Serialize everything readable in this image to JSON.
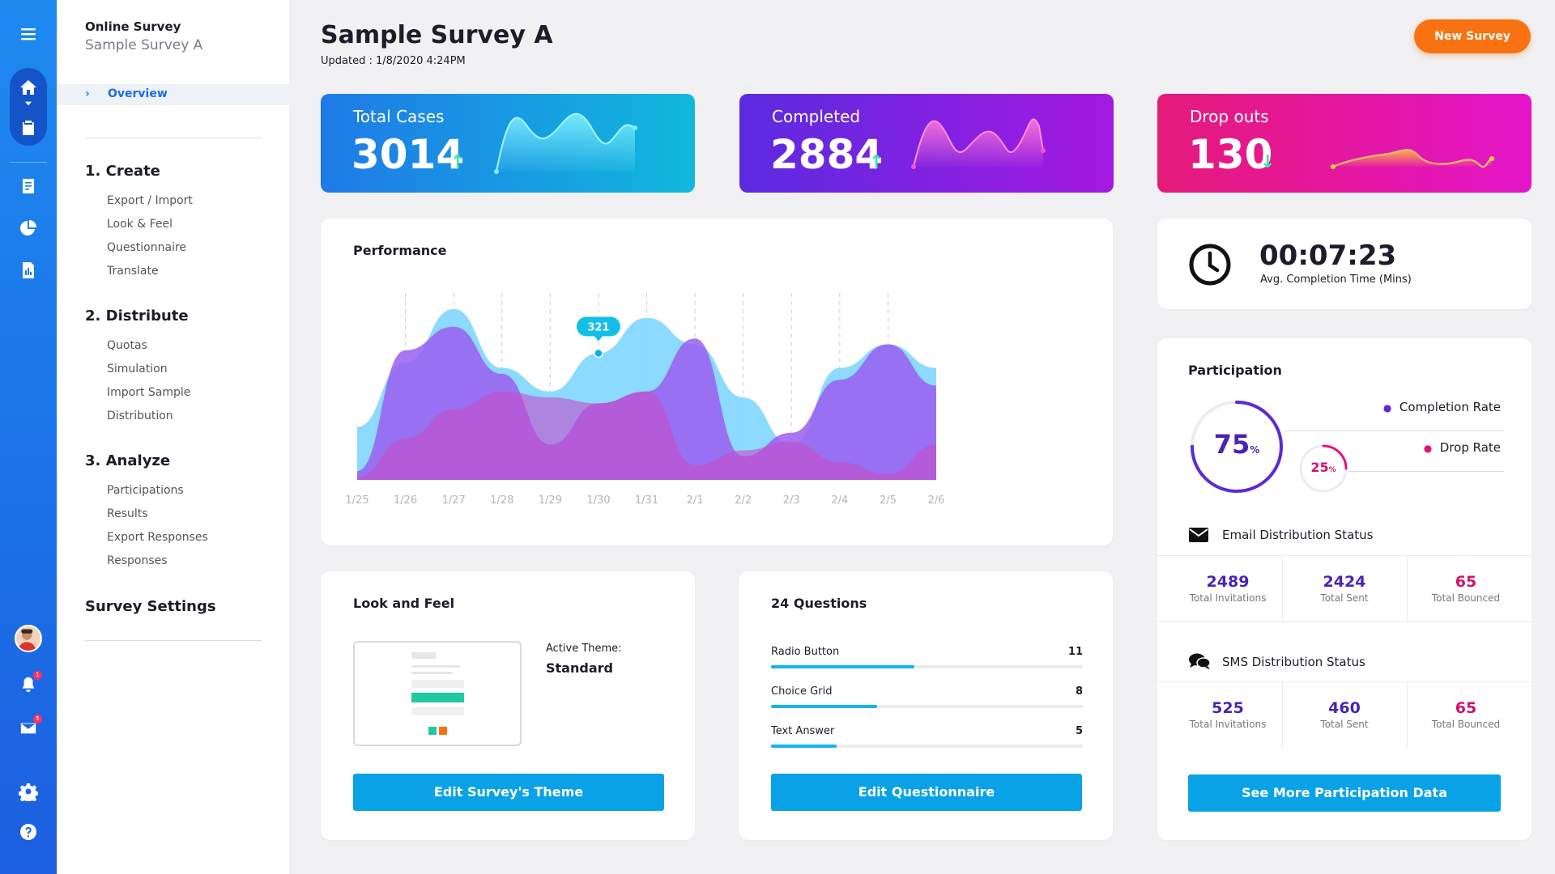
{
  "app": {
    "name": "Online Survey",
    "survey": "Sample Survey A"
  },
  "sidebar": {
    "overview": "Overview",
    "sections": [
      {
        "title": "1. Create",
        "items": [
          "Export / Import",
          "Look & Feel",
          "Questionnaire",
          "Translate"
        ]
      },
      {
        "title": "2. Distribute",
        "items": [
          "Quotas",
          "Simulation",
          "Import Sample",
          "Distribution"
        ]
      },
      {
        "title": "3. Analyze",
        "items": [
          "Participations",
          "Results",
          "Export Responses",
          "Responses"
        ]
      }
    ],
    "settings": "Survey Settings"
  },
  "rail": {
    "notif_badge": "1",
    "mail_badge": "5"
  },
  "header": {
    "title": "Sample Survey A",
    "updated": "Updated : 1/8/2020 4:24PM",
    "new_button": "New Survey"
  },
  "stats": [
    {
      "title": "Total Cases",
      "value": "3014",
      "trend": "up"
    },
    {
      "title": "Completed",
      "value": "2884",
      "trend": "up"
    },
    {
      "title": "Drop outs",
      "value": "130",
      "trend": "down"
    }
  ],
  "performance": {
    "title": "Performance",
    "tooltip": "321"
  },
  "chart_data": {
    "type": "area",
    "title": "Performance",
    "categories": [
      "1/25",
      "1/26",
      "1/27",
      "1/28",
      "1/29",
      "1/30",
      "1/31",
      "2/1",
      "2/2",
      "2/3",
      "2/4",
      "2/5",
      "2/6"
    ],
    "series": [
      {
        "values": [
          90,
          200,
          290,
          190,
          150,
          215,
          275,
          230,
          140,
          60,
          190,
          230,
          190
        ]
      },
      {
        "values": [
          15,
          220,
          260,
          180,
          60,
          130,
          150,
          240,
          40,
          80,
          170,
          230,
          160
        ]
      },
      {
        "values": [
          5,
          70,
          120,
          150,
          140,
          130,
          150,
          25,
          50,
          65,
          30,
          10,
          60
        ]
      }
    ],
    "ylim": [
      0,
      320
    ],
    "highlight": {
      "category": "1/30",
      "value": 321
    },
    "grid": "vertical dashed"
  },
  "avg_time": {
    "value": "00:07:23",
    "label": "Avg. Completion Time (Mins)"
  },
  "participation": {
    "title": "Participation",
    "completion": {
      "label": "Completion Rate",
      "value": "75",
      "unit": "%",
      "fraction": 0.75
    },
    "drop": {
      "label": "Drop Rate",
      "value": "25",
      "unit": "%",
      "fraction": 0.25
    },
    "email": {
      "title": "Email Distribution Status",
      "stats": [
        {
          "value": "2489",
          "label": "Total Invitations"
        },
        {
          "value": "2424",
          "label": "Total Sent"
        },
        {
          "value": "65",
          "label": "Total Bounced"
        }
      ]
    },
    "sms": {
      "title": "SMS Distribution Status",
      "stats": [
        {
          "value": "525",
          "label": "Total Invitations"
        },
        {
          "value": "460",
          "label": "Total Sent"
        },
        {
          "value": "65",
          "label": "Total Bounced"
        }
      ]
    },
    "button": "See More Participation Data"
  },
  "look": {
    "title": "Look and Feel",
    "theme_label": "Active Theme:",
    "theme": "Standard",
    "button": "Edit Survey's Theme"
  },
  "questions": {
    "title": "24 Questions",
    "items": [
      {
        "label": "Radio Button",
        "count": "11",
        "fraction": 0.46
      },
      {
        "label": "Choice Grid",
        "count": "8",
        "fraction": 0.34
      },
      {
        "label": "Text Answer",
        "count": "5",
        "fraction": 0.21
      }
    ],
    "button": "Edit Questionnaire"
  },
  "colors": {
    "accent": "#0aa2e6",
    "orange": "#f97212",
    "purple": "#5b2bd6",
    "pink": "#e0157a",
    "cyan": "#12b6e8"
  }
}
